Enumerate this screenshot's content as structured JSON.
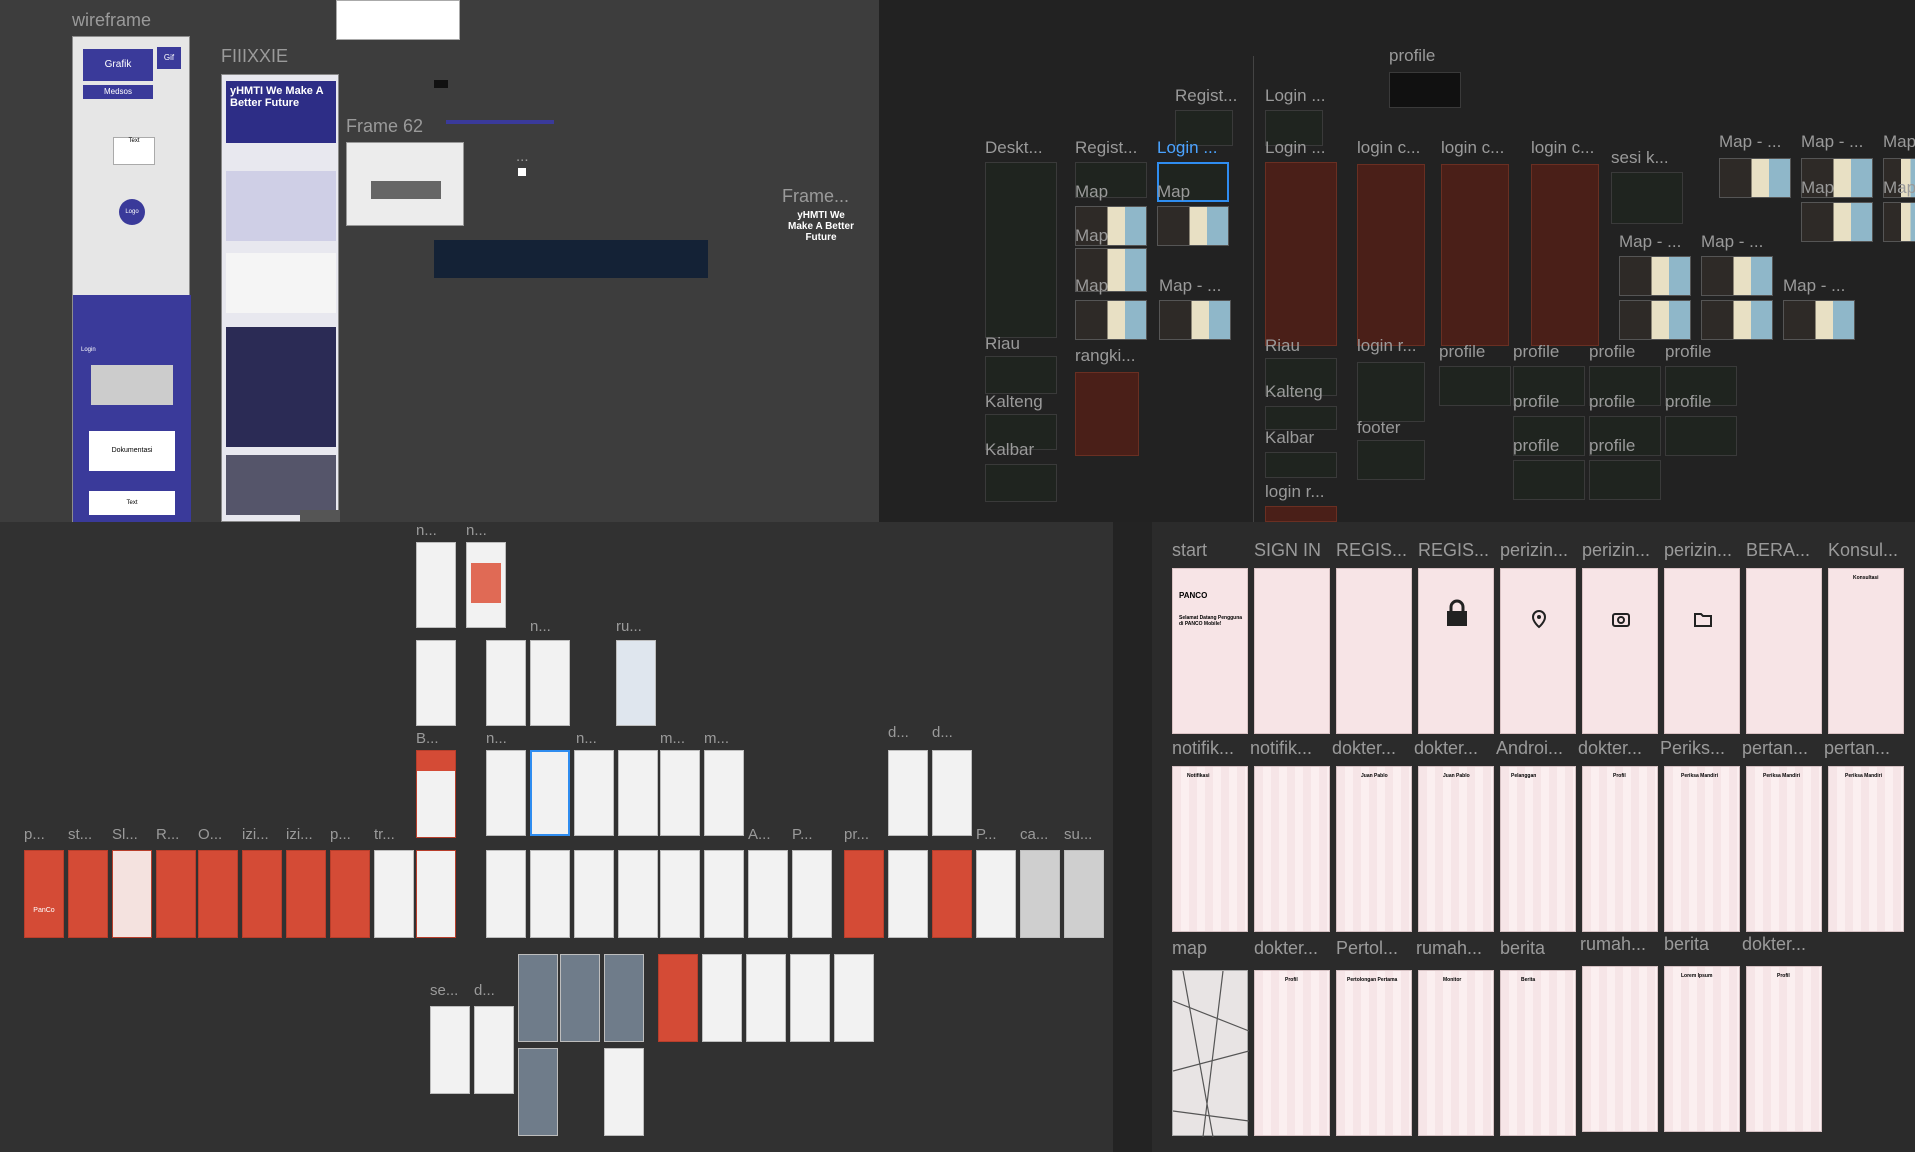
{
  "canvas": {
    "q1_labels": {
      "wireframe": "wireframe",
      "fiiixxie": "FIIIXXIE",
      "frame62": "Frame 62",
      "frame_dots": "Frame...",
      "dots": "..."
    },
    "q1_text": {
      "grafik": "Grafik",
      "gif": "Gif",
      "medsos": "Medsos",
      "text1": "Text",
      "logo": "Logo",
      "login": "Login",
      "dokumentasi": "Dokumentasi",
      "text2": "Text",
      "poster_title": "yHMTI We Make A Better Future",
      "poster_small": "yHMTI We Make A Better Future"
    },
    "q2_labels": {
      "profile_top": "profile",
      "regist_top": "Regist...",
      "login_top": "Login ...",
      "deskt": "Deskt...",
      "regist": "Regist...",
      "login_sel": "Login ...",
      "login2": "Login ...",
      "login_c1": "login c...",
      "login_c2": "login c...",
      "login_c3": "login c...",
      "sesi_k": "sesi k...",
      "map1": "Map - ...",
      "map2": "Map - ...",
      "map3": "Map",
      "map_a": "Map",
      "map_b": "Map",
      "map_c": "Map",
      "map_d": "Map",
      "map_e": "Map - ...",
      "map_f": "Map - ...",
      "map_g": "Map - ...",
      "map_h": "Map - ...",
      "map_i": "Map",
      "map_j": "Map",
      "map_k": "Map - ...",
      "riau1": "Riau",
      "kalteng1": "Kalteng",
      "kalbar1": "Kalbar",
      "rangki": "rangki...",
      "riau2": "Riau",
      "login_r": "login r...",
      "kalteng2": "Kalteng",
      "kalbar2": "Kalbar",
      "footer": "footer",
      "login_r2": "login r...",
      "profile_a": "profile",
      "profile_b": "profile",
      "profile_c": "profile",
      "profile_d": "profile",
      "profile_e": "profile",
      "profile_f": "profile",
      "profile_g": "profile",
      "profile_h": "profile",
      "profile_i": "profile"
    },
    "q3_labels": {
      "n1": "n...",
      "n2": "n...",
      "n3": "n...",
      "ru": "ru...",
      "b1": "B...",
      "n4": "n...",
      "n5": "n...",
      "m1": "m...",
      "m2": "m...",
      "d1": "d...",
      "d2": "d...",
      "p1": "p...",
      "st": "st...",
      "sl": "Sl...",
      "r": "R...",
      "o": "O...",
      "izi1": "izi...",
      "izi2": "izi...",
      "p2": "p...",
      "tr": "tr...",
      "a": "A...",
      "p3": "P...",
      "pr": "pr...",
      "p4": "P...",
      "ca": "ca...",
      "su": "su...",
      "se": "se...",
      "d3": "d...",
      "panco": "PanCo"
    },
    "q4_labels": {
      "start": "start",
      "signin": "SIGN IN",
      "regis1": "REGIS...",
      "regis2": "REGIS...",
      "perizin1": "perizin...",
      "perizin2": "perizin...",
      "perizin3": "perizin...",
      "bera": "BERA...",
      "konsul": "Konsul...",
      "notifik1": "notifik...",
      "notifik2": "notifik...",
      "dokter1": "dokter...",
      "dokter2": "dokter...",
      "androi": "Androi...",
      "dokter3": "dokter...",
      "periks": "Periks...",
      "pertan1": "pertan...",
      "pertan2": "pertan...",
      "map": "map",
      "dokter4": "dokter...",
      "pertol": "Pertol...",
      "rumah1": "rumah...",
      "berita1": "berita",
      "rumah2": "rumah...",
      "berita2": "berita",
      "dokter5": "dokter..."
    },
    "q4_screens": {
      "panco": "PANCO",
      "welcome": "Selamat Datang Pengguna di PANCO Mobile!",
      "notifikasi": "Notifikasi",
      "juan_pablo": "Juan Pablo",
      "profil": "Profil",
      "pelanggan": "Pelanggan",
      "berita": "Berita",
      "periksa_mandiri": "Periksa Mandiri",
      "monitor": "Monitor",
      "lorem_ipsum": "Lorem Ipsum",
      "konsultasi": "Konsultasi",
      "pertolongan_pertama": "Pertolongan Pertama"
    }
  }
}
